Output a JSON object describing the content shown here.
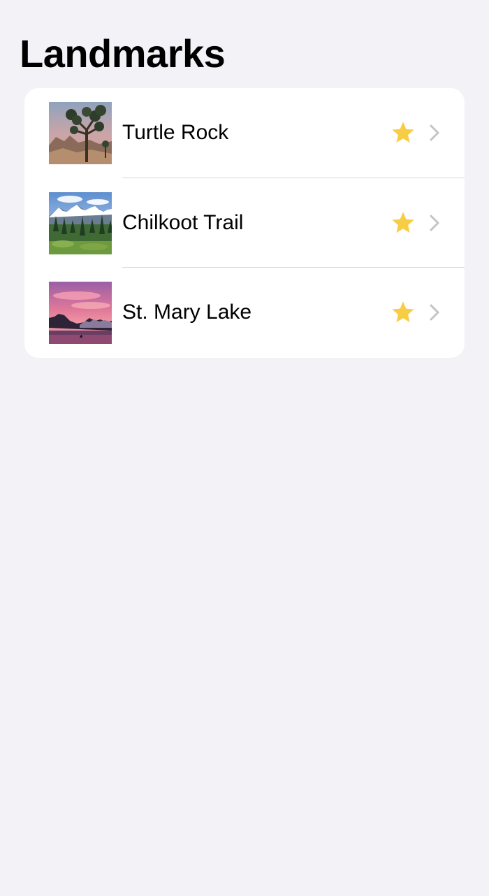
{
  "header": {
    "title": "Landmarks"
  },
  "landmarks": [
    {
      "name": "Turtle Rock",
      "favorite": true,
      "thumbnail": "joshua-tree-desert-photo"
    },
    {
      "name": "Chilkoot Trail",
      "favorite": true,
      "thumbnail": "snowy-mountains-forest-photo"
    },
    {
      "name": "St. Mary Lake",
      "favorite": true,
      "thumbnail": "pink-sunset-lake-photo"
    }
  ],
  "icons": {
    "favorite": "star-icon",
    "disclosure": "chevron-right-icon"
  },
  "colors": {
    "background": "#f2f2f7",
    "card": "#ffffff",
    "star": "#f8cd46",
    "chevron": "#c4c4c7",
    "separator": "#d6d6da"
  }
}
